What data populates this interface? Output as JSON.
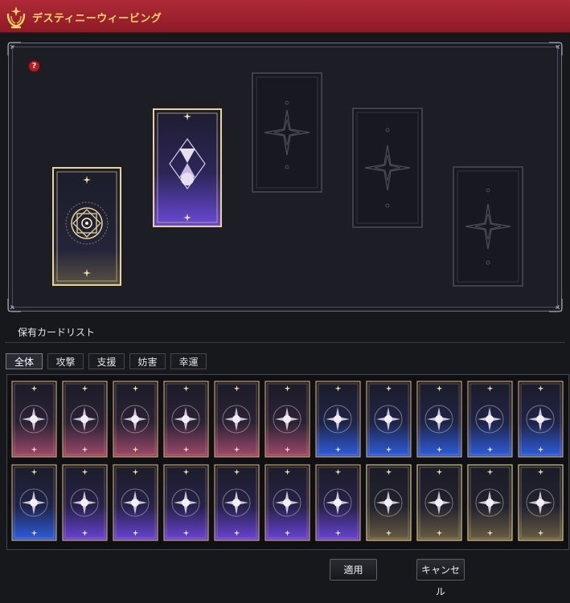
{
  "window": {
    "title": "デスティニーウィービング"
  },
  "help": {
    "glyph": "?"
  },
  "board": {
    "slots": [
      {
        "state": "filled",
        "emblem": "dharma-wheel-icon"
      },
      {
        "state": "filled",
        "emblem": "hourglass-icon"
      },
      {
        "state": "empty",
        "emblem": "compass-star-icon"
      },
      {
        "state": "empty",
        "emblem": "compass-star-icon"
      },
      {
        "state": "empty",
        "emblem": "compass-star-icon"
      }
    ]
  },
  "inventory": {
    "label": "保有カードリスト",
    "tabs": [
      {
        "label": "全体",
        "active": true
      },
      {
        "label": "攻撃",
        "active": false
      },
      {
        "label": "支援",
        "active": false
      },
      {
        "label": "妨害",
        "active": false
      },
      {
        "label": "幸運",
        "active": false
      }
    ],
    "rows": [
      [
        {
          "theme": "red",
          "icon": "lion-icon"
        },
        {
          "theme": "red",
          "icon": "queen-icon"
        },
        {
          "theme": "red",
          "icon": "lion-face-icon"
        },
        {
          "theme": "red",
          "icon": "sun-icon"
        },
        {
          "theme": "red",
          "icon": "scales-icon"
        },
        {
          "theme": "red",
          "icon": "horn-icon"
        },
        {
          "theme": "blue",
          "icon": "elephant-god-icon"
        },
        {
          "theme": "blue",
          "icon": "king-icon"
        },
        {
          "theme": "blue",
          "icon": "lovers-icon"
        },
        {
          "theme": "blue",
          "icon": "chariot-icon"
        },
        {
          "theme": "blue",
          "icon": "moon-icon"
        }
      ],
      [
        {
          "theme": "blue",
          "icon": "tower-icon"
        },
        {
          "theme": "purple",
          "icon": "hourglass-icon"
        },
        {
          "theme": "purple",
          "icon": "wreath-star-icon"
        },
        {
          "theme": "purple",
          "icon": "crossed-tools-icon"
        },
        {
          "theme": "purple",
          "icon": "hermit-icon"
        },
        {
          "theme": "purple",
          "icon": "witch-icon"
        },
        {
          "theme": "purple",
          "icon": "moon-face-icon"
        },
        {
          "theme": "gold",
          "icon": "sun-orb-icon"
        },
        {
          "theme": "gold",
          "icon": "horned-emblem-icon"
        },
        {
          "theme": "gold",
          "icon": "dharma-wheel-icon"
        },
        {
          "theme": "gold",
          "icon": "star-icon"
        }
      ]
    ]
  },
  "buttons": {
    "apply": "適用",
    "cancel": "キャンセル"
  },
  "colors": {
    "titlebar": "#a0222f",
    "title_text": "#ffd66a",
    "gold": "#e8d49a",
    "red_theme": "#c85a78",
    "blue_theme": "#3a6ee8",
    "purple_theme": "#6a3ec8",
    "empty_frame": "#4a4c56"
  }
}
